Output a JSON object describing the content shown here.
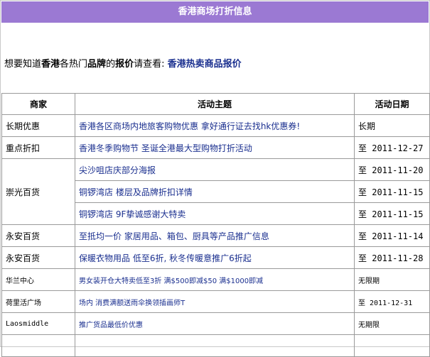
{
  "title": "香港商场打折信息",
  "intro": {
    "prefix": "想要知道",
    "bold1": "香港",
    "middle1": "各热门",
    "bold2": "品牌",
    "middle2": "的",
    "bold3": "报价",
    "middle3": "请查看: ",
    "link": "香港热卖商品报价"
  },
  "table": {
    "headers": {
      "merchant": "商家",
      "topic": "活动主题",
      "date": "活动日期"
    },
    "rows": [
      {
        "merchant": "长期优惠",
        "topic": "香港各区商场内地旅客购物优惠 拿好通行证去找hk优惠券!",
        "date": "长期"
      },
      {
        "merchant": "重点折扣",
        "topic": "香港冬季购物节 圣诞全港最大型购物打折活动",
        "date": "至 2011-12-27"
      },
      {
        "merchant": "崇光百货",
        "topic": "尖沙咀店庆部分海报",
        "date": "至 2011-11-20"
      },
      {
        "merchant": "",
        "topic": "铜锣湾店 楼层及品牌折扣详情",
        "date": "至 2011-11-15"
      },
      {
        "merchant": "",
        "topic": "铜锣湾店 9F挚诚感谢大特卖",
        "date": "至 2011-11-15"
      },
      {
        "merchant": "永安百货",
        "topic": "至抵均一价 家居用品、箱包、厨具等产品推广信息",
        "date": "至 2011-11-14"
      },
      {
        "merchant": "永安百货",
        "topic": "保暖衣物用品 低至6折, 秋冬传暖意推广6折起",
        "date": "至 2011-11-28"
      },
      {
        "merchant": "华兰中心",
        "topic": "男女装开仓大特卖低至3折 满$500即减$50 满$1000即减",
        "date": "无限期"
      },
      {
        "merchant": "荷里活广场",
        "topic": "场内 消费满额送雨伞换领插画师T",
        "date": "至 2011-12-31"
      },
      {
        "merchant": "Laosmiddle",
        "topic": "推广货品最低价优惠",
        "date": "无期限"
      },
      {
        "merchant": "",
        "topic": "",
        "date": ""
      }
    ]
  },
  "colors": {
    "title_bg": "#9b79d3",
    "link": "#1a2f8f",
    "border": "#9a9a9a"
  }
}
